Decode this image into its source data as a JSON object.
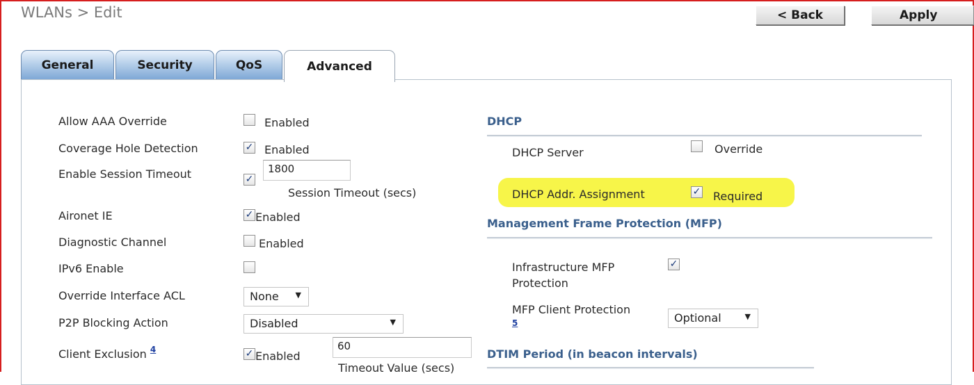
{
  "page": {
    "title": "WLANs > Edit"
  },
  "toolbar": {
    "back_label": "< Back",
    "apply_label": "Apply"
  },
  "tabs": [
    {
      "label": "General"
    },
    {
      "label": "Security"
    },
    {
      "label": "QoS"
    },
    {
      "label": "Advanced",
      "active": true
    }
  ],
  "left": {
    "aaa_override": {
      "label": "Allow AAA Override",
      "checked": false,
      "text": "Enabled"
    },
    "coverage_hole": {
      "label": "Coverage Hole Detection",
      "checked": true,
      "text": "Enabled"
    },
    "session_timeout": {
      "label": "Enable Session Timeout",
      "checked": true,
      "value": "1800",
      "caption": "Session Timeout (secs)"
    },
    "aironet_ie": {
      "label": "Aironet IE",
      "checked": true,
      "text": "Enabled"
    },
    "diagnostic_channel": {
      "label": "Diagnostic Channel",
      "checked": false,
      "text": "Enabled"
    },
    "ipv6": {
      "label": "IPv6 Enable",
      "checked": false
    },
    "override_acl": {
      "label": "Override Interface ACL",
      "selected": "None"
    },
    "p2p_blocking": {
      "label": "P2P Blocking Action",
      "selected": "Disabled"
    },
    "client_exclusion": {
      "label": "Client Exclusion",
      "footnote": "4",
      "checked": true,
      "text": "Enabled",
      "value": "60",
      "caption": "Timeout Value (secs)"
    }
  },
  "right": {
    "dhcp": {
      "title": "DHCP",
      "server": {
        "label": "DHCP Server",
        "checked": false,
        "text": "Override"
      },
      "assignment": {
        "label": "DHCP Addr. Assignment",
        "checked": true,
        "text": "Required",
        "highlight_color": "#f6f435"
      }
    },
    "mfp": {
      "title": "Management Frame Protection (MFP)",
      "infrastructure": {
        "label_line1": "Infrastructure MFP",
        "label_line2": "Protection",
        "checked": true
      },
      "client": {
        "label": "MFP Client Protection",
        "footnote": "5",
        "selected": "Optional"
      }
    },
    "dtim": {
      "title": "DTIM Period (in beacon intervals)"
    }
  },
  "colors": {
    "frame": "#d61e1e",
    "tab": "#7fa8d6",
    "section_title": "#3a5f8c"
  },
  "check_glyph": "✓"
}
